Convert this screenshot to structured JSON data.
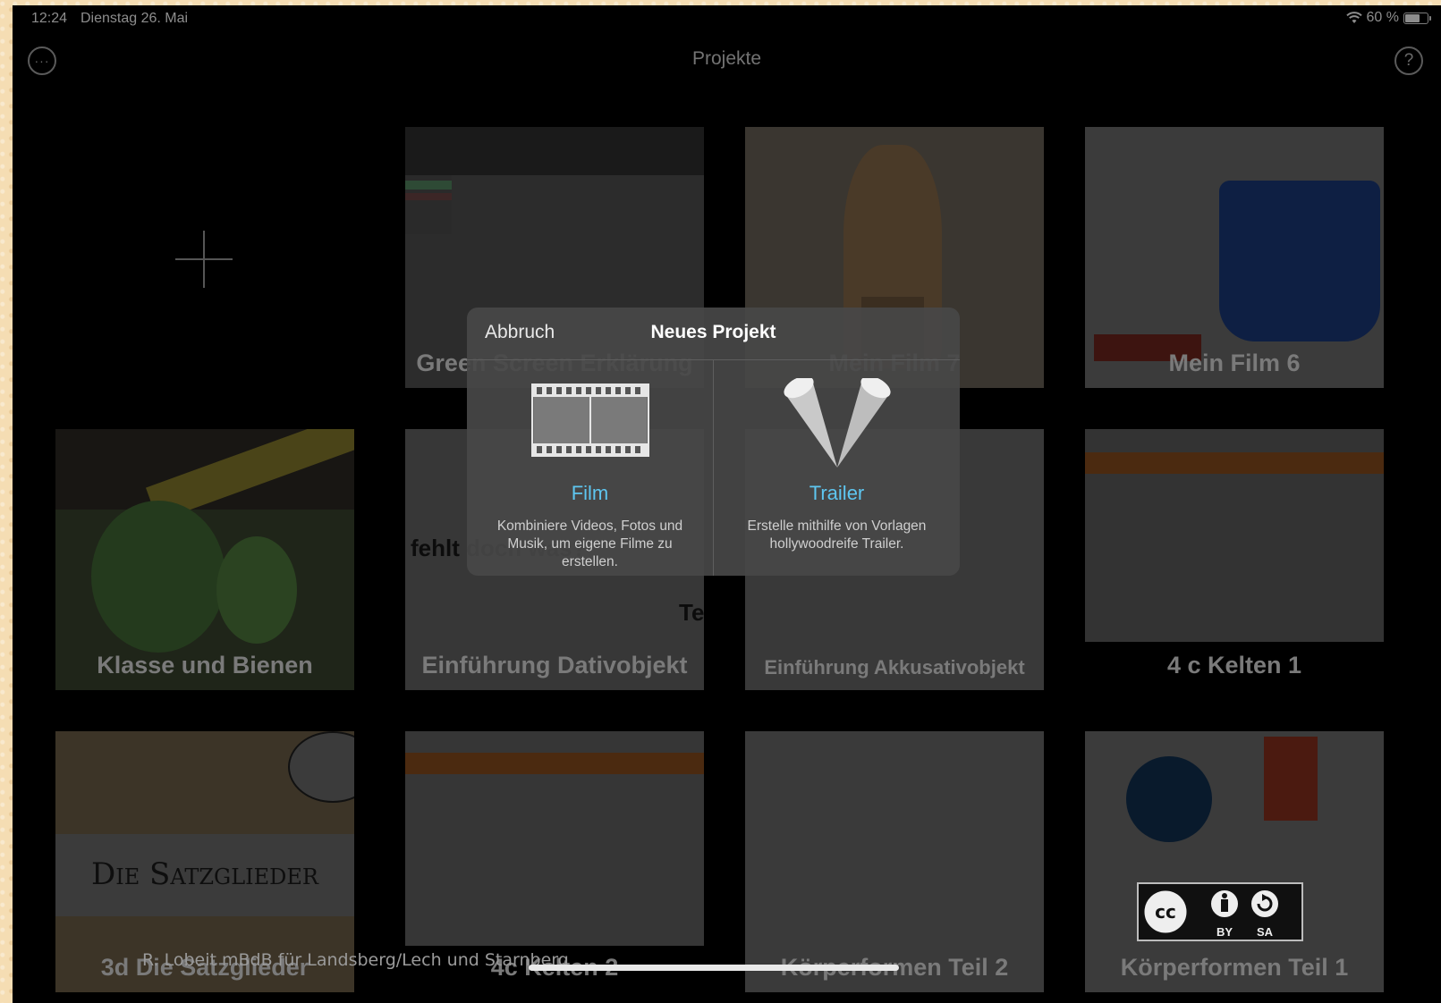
{
  "status_bar": {
    "time": "12:24",
    "date": "Dienstag 26. Mai",
    "battery": "60 %",
    "battery_level": 0.6
  },
  "nav": {
    "title": "Projekte",
    "more_icon": "ellipsis-circle-icon",
    "help_icon": "question-circle-icon",
    "more_glyph": "···",
    "help_glyph": "?"
  },
  "projects": [
    {
      "label": "Green Screen Erklärung"
    },
    {
      "label": "Mein Film 7"
    },
    {
      "label": "Mein Film 6"
    },
    {
      "label": "Klasse und Bienen"
    },
    {
      "label": "Einführung Dativobjekt",
      "snippet": "fehlt doch was?",
      "snippet2": "Te"
    },
    {
      "label": "Einführung Akkusativobjekt"
    },
    {
      "label": "4 c Kelten 1"
    },
    {
      "label": "3d Die Satzglieder",
      "thumb_text": "Die Satzglieder"
    },
    {
      "label": "4c Kelten 2"
    },
    {
      "label": "Körperformen Teil 2"
    },
    {
      "label": "Körperformen Teil 1"
    }
  ],
  "popover": {
    "cancel": "Abbruch",
    "title": "Neues Projekt",
    "options": [
      {
        "label": "Film",
        "icon": "film-strip-icon",
        "description": "Kombiniere Videos, Fotos und Musik, um eigene Filme zu erstellen."
      },
      {
        "label": "Trailer",
        "icon": "spotlight-icon",
        "description": "Erstelle mithilfe von Vorlagen hollywoodreife Trailer."
      }
    ]
  },
  "footer": {
    "credit": "R. Lobeit mBdB für Landsberg/Lech und Starnberg",
    "license": {
      "icon": "cc-by-sa-icon",
      "by": "BY",
      "sa": "SA",
      "cc": "cc"
    }
  },
  "colors": {
    "accent": "#5ec6f0",
    "popover_bg": "#484848",
    "screen_bg": "#000000",
    "frame": "#f5ddb3"
  }
}
